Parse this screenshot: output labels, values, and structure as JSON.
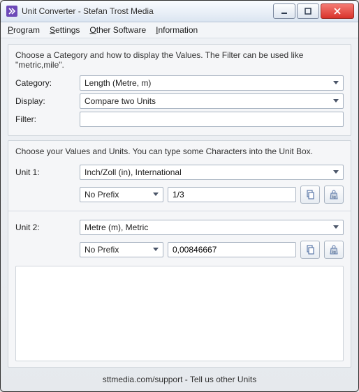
{
  "window": {
    "title": "Unit Converter - Stefan Trost Media"
  },
  "menu": {
    "program": "Program",
    "settings": "Settings",
    "other_software": "Other Software",
    "information": "Information"
  },
  "section1": {
    "hint": "Choose a Category and how to display the Values. The Filter can be used like \"metric,mile\".",
    "category_label": "Category:",
    "category_value": "Length (Metre, m)",
    "display_label": "Display:",
    "display_value": "Compare two Units",
    "filter_label": "Filter:",
    "filter_value": ""
  },
  "section2": {
    "hint": "Choose your Values and Units. You can type some Characters into the Unit Box.",
    "unit1_label": "Unit 1:",
    "unit1_value": "Inch/Zoll (in), International",
    "unit1_prefix": "No Prefix",
    "unit1_input": "1/3",
    "unit2_label": "Unit 2:",
    "unit2_value": "Metre (m), Metric",
    "unit2_prefix": "No Prefix",
    "unit2_input": "0,00846667"
  },
  "footer": {
    "text": "sttmedia.com/support - Tell us other Units"
  }
}
